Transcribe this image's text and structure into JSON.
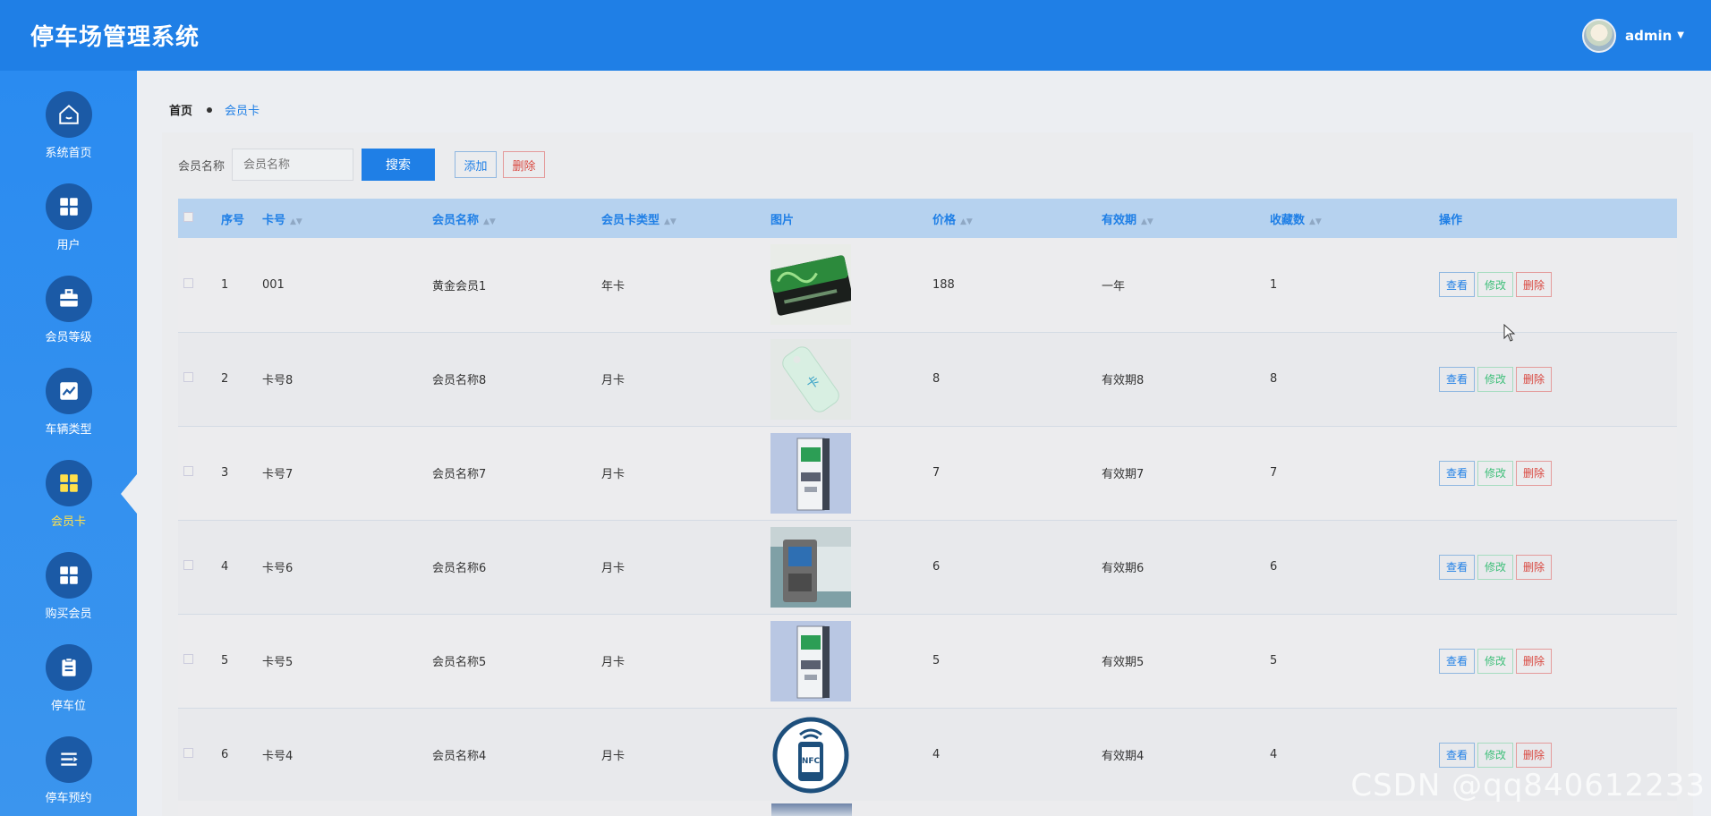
{
  "header": {
    "title": "停车场管理系统",
    "username": "admin"
  },
  "sidebar": {
    "items": [
      {
        "label": "系统首页",
        "icon": "home-icon"
      },
      {
        "label": "用户",
        "icon": "grid-icon"
      },
      {
        "label": "会员等级",
        "icon": "briefcase-icon"
      },
      {
        "label": "车辆类型",
        "icon": "chart-icon"
      },
      {
        "label": "会员卡",
        "icon": "grid-icon",
        "active": true
      },
      {
        "label": "购买会员",
        "icon": "grid-icon"
      },
      {
        "label": "停车位",
        "icon": "clipboard-icon"
      },
      {
        "label": "停车预约",
        "icon": "list-icon"
      }
    ]
  },
  "breadcrumb": {
    "home": "首页",
    "current": "会员卡"
  },
  "search": {
    "label": "会员名称",
    "placeholder": "会员名称",
    "search_button": "搜索",
    "add_button": "添加",
    "delete_button": "删除"
  },
  "table": {
    "headers": {
      "index": "序号",
      "card_no": "卡号",
      "member_name": "会员名称",
      "card_type": "会员卡类型",
      "image": "图片",
      "price": "价格",
      "validity": "有效期",
      "favorites": "收藏数",
      "actions": "操作"
    },
    "actions": {
      "view": "查看",
      "edit": "修改",
      "delete": "删除"
    },
    "rows": [
      {
        "index": "1",
        "card_no": "001",
        "member_name": "黄金会员1",
        "card_type": "年卡",
        "image": "green-membership-card-image",
        "price": "188",
        "validity": "一年",
        "favorites": "1"
      },
      {
        "index": "2",
        "card_no": "卡号8",
        "member_name": "会员名称8",
        "card_type": "月卡",
        "image": "key-tag-card-image",
        "price": "8",
        "validity": "有效期8",
        "favorites": "8"
      },
      {
        "index": "3",
        "card_no": "卡号7",
        "member_name": "会员名称7",
        "card_type": "月卡",
        "image": "kiosk-machine-image",
        "price": "7",
        "validity": "有效期7",
        "favorites": "7"
      },
      {
        "index": "4",
        "card_no": "卡号6",
        "member_name": "会员名称6",
        "card_type": "月卡",
        "image": "bus-card-reader-image",
        "price": "6",
        "validity": "有效期6",
        "favorites": "6"
      },
      {
        "index": "5",
        "card_no": "卡号5",
        "member_name": "会员名称5",
        "card_type": "月卡",
        "image": "kiosk-machine-image",
        "price": "5",
        "validity": "有效期5",
        "favorites": "5"
      },
      {
        "index": "6",
        "card_no": "卡号4",
        "member_name": "会员名称4",
        "card_type": "月卡",
        "image": "nfc-phone-image",
        "price": "4",
        "validity": "有效期4",
        "favorites": "4"
      }
    ]
  },
  "watermark": "CSDN @qq840612233",
  "colors": {
    "primary": "#1f7fe6",
    "header_bg": "#1f7fe6",
    "sidebar_bg": "#2a8bf0",
    "active_nav": "#ffe04a",
    "edit": "#3fbf7a",
    "danger": "#d9473f",
    "table_header_bg": "#b6d2ef"
  }
}
